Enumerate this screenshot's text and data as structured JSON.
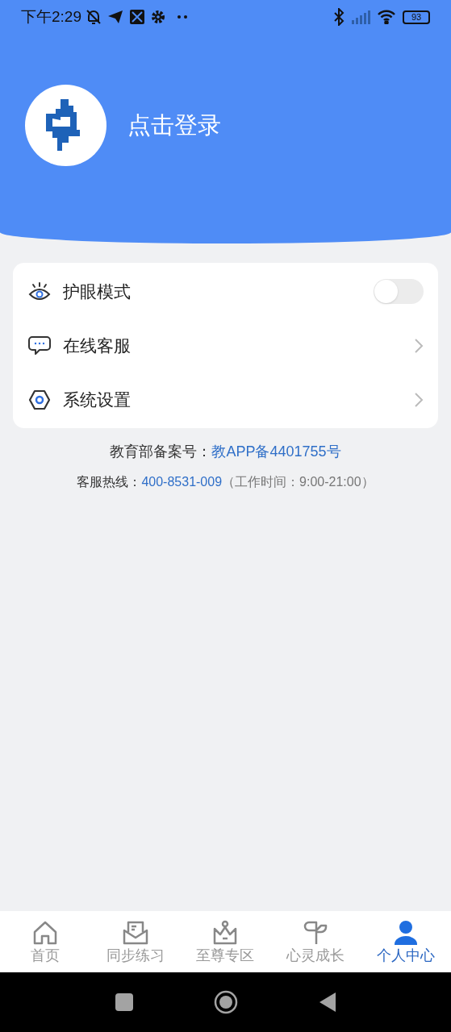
{
  "status_bar": {
    "time": "下午2:29",
    "battery": "93"
  },
  "header": {
    "login": "点击登录"
  },
  "menu": [
    {
      "kind": "toggle",
      "label": "护眼模式",
      "on": false
    },
    {
      "kind": "link",
      "label": "在线客服"
    },
    {
      "kind": "link",
      "label": "系统设置"
    }
  ],
  "footer": [
    {
      "label": "教育部备案号：",
      "link": "教APP备4401755号"
    },
    {
      "label": "客服热线：",
      "link": "400-8531-009",
      "note": "（工作时间：9:00-21:00）"
    }
  ],
  "tabs": [
    {
      "label": "首页",
      "selected": false
    },
    {
      "label": "同步练习",
      "selected": false
    },
    {
      "label": "至尊专区",
      "selected": false
    },
    {
      "label": "心灵成长",
      "selected": false
    },
    {
      "label": "个人中心",
      "selected": true
    }
  ]
}
